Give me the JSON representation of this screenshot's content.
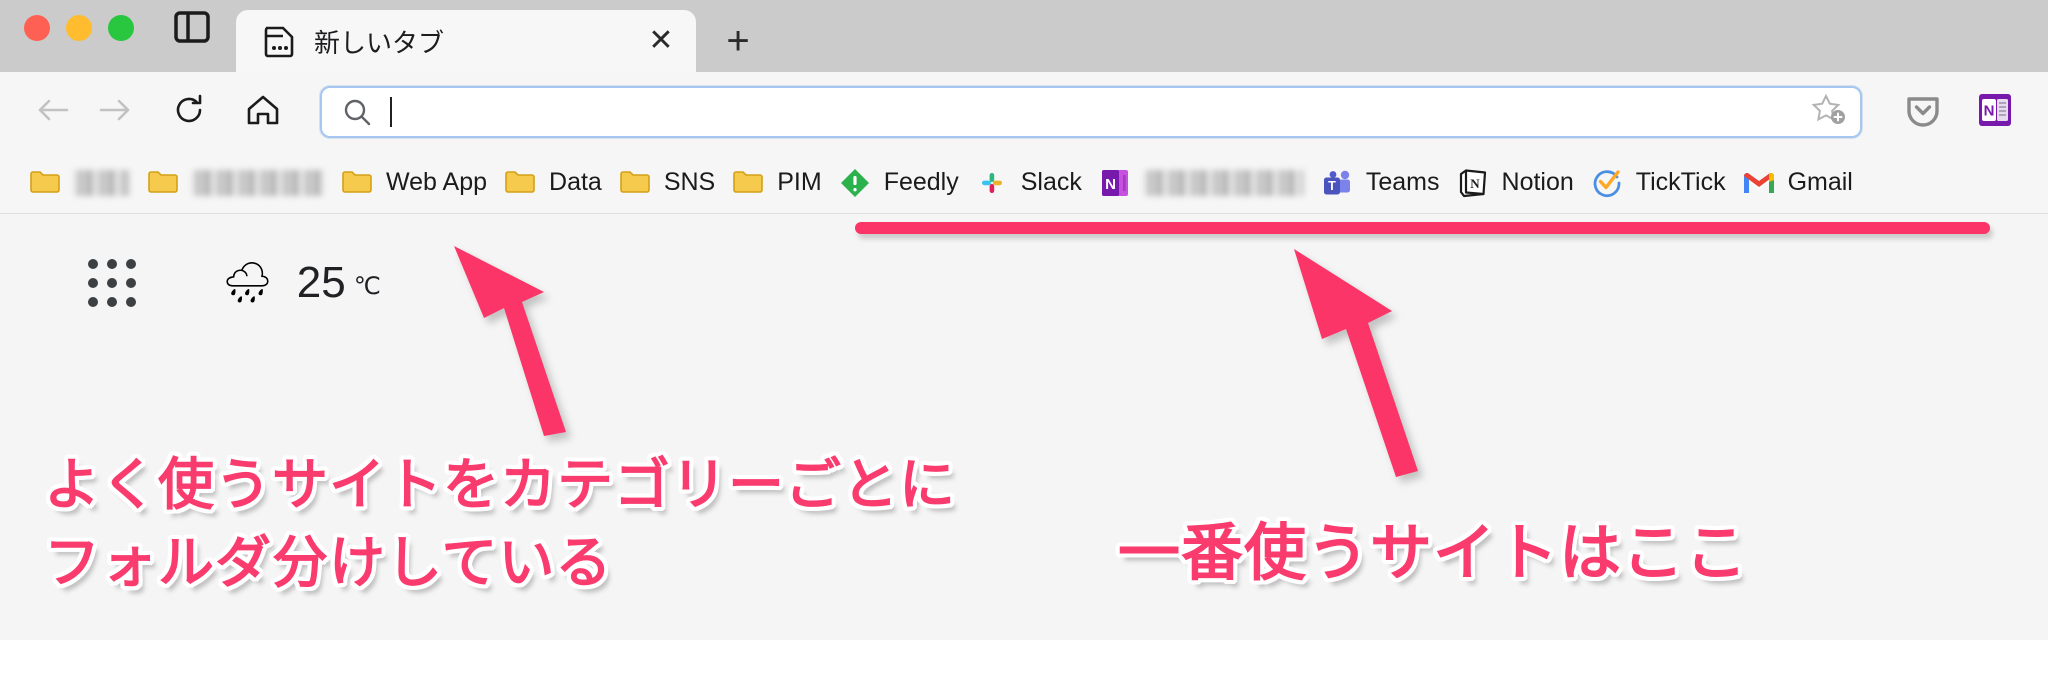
{
  "window": {
    "traffic_lights": [
      "close",
      "minimize",
      "zoom"
    ],
    "colors": {
      "close": "#ff6054",
      "minimize": "#ffbc2e",
      "zoom": "#29c63f",
      "annotation_pink": "#fa3b6e",
      "tabbar_bg": "#cbcbcb",
      "toolbar_bg": "#f6f6f6",
      "page_bg": "#f5f5f5",
      "address_focus_border": "#a8c7f0"
    }
  },
  "tabbar": {
    "sidebar_toggle_icon": "sidebar-panel-icon",
    "tabs": [
      {
        "favicon": "new-tab-page-icon",
        "title": "新しいタブ",
        "close_label": "✕",
        "active": true
      }
    ],
    "new_tab_label": "+"
  },
  "toolbar": {
    "back_icon": "arrow-left-icon",
    "forward_icon": "arrow-right-icon",
    "reload_icon": "reload-icon",
    "home_icon": "home-icon",
    "back_enabled": false,
    "forward_enabled": false,
    "address": {
      "search_icon": "search-icon",
      "value": "",
      "placeholder": "",
      "bookmark_icon": "star-plus-icon",
      "focused": true
    },
    "extensions": [
      {
        "name": "pocket-icon",
        "label": "Pocket"
      },
      {
        "name": "onenote-icon",
        "label": "OneNote Web Clipper"
      }
    ]
  },
  "bookmarks_bar": {
    "items": [
      {
        "type": "folder",
        "label": "",
        "redacted": true,
        "redact_width": "w1"
      },
      {
        "type": "folder",
        "label": "",
        "redacted": true,
        "redact_width": "w2"
      },
      {
        "type": "folder",
        "label": "Web App",
        "redacted": false
      },
      {
        "type": "folder",
        "label": "Data",
        "redacted": false
      },
      {
        "type": "folder",
        "label": "SNS",
        "redacted": false
      },
      {
        "type": "folder",
        "label": "PIM",
        "redacted": false
      },
      {
        "type": "site",
        "icon": "feedly-icon",
        "label": "Feedly",
        "redacted": false
      },
      {
        "type": "site",
        "icon": "slack-icon",
        "label": "Slack",
        "redacted": false
      },
      {
        "type": "site",
        "icon": "onenote-icon",
        "label": "",
        "redacted": true,
        "redact_width": "w3"
      },
      {
        "type": "site",
        "icon": "teams-icon",
        "label": "Teams",
        "redacted": false
      },
      {
        "type": "site",
        "icon": "notion-icon",
        "label": "Notion",
        "redacted": false
      },
      {
        "type": "site",
        "icon": "ticktick-icon",
        "label": "TickTick",
        "redacted": false
      },
      {
        "type": "site",
        "icon": "gmail-icon",
        "label": "Gmail",
        "redacted": false
      }
    ]
  },
  "page": {
    "apps_launcher_icon": "app-grid-icon",
    "weather": {
      "icon": "rain-cloud-icon",
      "emoji": "🌧",
      "temperature": "25",
      "unit": "℃"
    }
  },
  "annotations": {
    "left_line1": "よく使うサイトをカテゴリーごとに",
    "left_line2": "フォルダ分けしている",
    "right_line1": "一番使うサイトはここ",
    "underline": {
      "name": "bookmark-highlight-bar",
      "color": "#fb3567"
    },
    "arrows": [
      {
        "name": "annotation-arrow-left",
        "points_to": "bookmark-folders"
      },
      {
        "name": "annotation-arrow-right",
        "points_to": "bookmark-sites"
      }
    ]
  }
}
